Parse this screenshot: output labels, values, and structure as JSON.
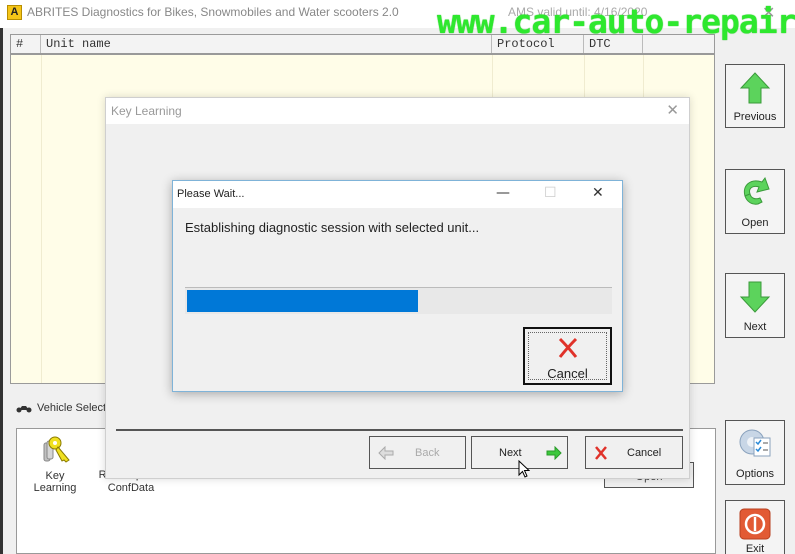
{
  "window": {
    "app_icon_letter": "A",
    "title": "ABRITES Diagnostics for Bikes, Snowmobiles and Water scooters 2.0",
    "ams_status": "AMS valid until: 4/16/2020",
    "close_glyph": "✕"
  },
  "watermark": "www.car-auto-repair.com",
  "grid": {
    "columns": [
      "#",
      "Unit name",
      "Protocol",
      "DTC",
      ""
    ],
    "rows": []
  },
  "toolbar": {
    "previous_label": "Previous",
    "open_label": "Open",
    "next_label": "Next",
    "options_label": "Options",
    "exit_label": "Exit"
  },
  "lower_panel": {
    "tab_label": "Vehicle Selection",
    "functions": [
      {
        "label": "Key Learning",
        "icon": "keys-icon"
      },
      {
        "label": "Read/Update ConfData",
        "icon": "config-icon"
      }
    ],
    "open_label": "Open"
  },
  "wizard": {
    "title": "Key Learning",
    "close_glyph": "✕",
    "back_label": "Back",
    "next_label": "Next",
    "cancel_label": "Cancel"
  },
  "please_wait": {
    "title": "Please Wait...",
    "minimize_glyph": "—",
    "maximize_glyph": "☐",
    "close_glyph": "✕",
    "message": "Establishing diagnostic session with selected unit...",
    "progress_percent": 55,
    "progress_color": "#0078d7",
    "cancel_label": "Cancel"
  }
}
